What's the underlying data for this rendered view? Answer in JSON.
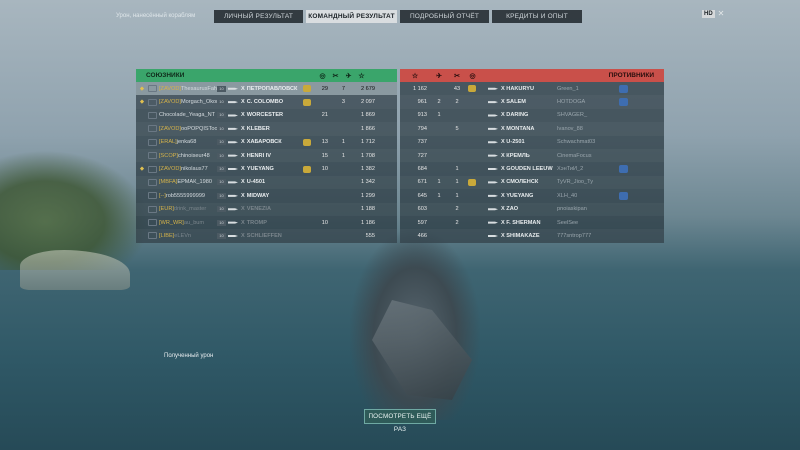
{
  "top_left_label": "Урон, нанесённый кораблям",
  "tabs": [
    {
      "label": "ЛИЧНЫЙ РЕЗУЛЬТАТ",
      "active": false
    },
    {
      "label": "КОМАНДНЫЙ РЕЗУЛЬТАТ",
      "active": true
    },
    {
      "label": "ПОДРОБНЫЙ ОТЧЁТ",
      "active": false
    },
    {
      "label": "КРЕДИТЫ И ОПЫТ",
      "active": false
    }
  ],
  "top_right": {
    "hd_badge": "HD"
  },
  "allies": {
    "title": "СОЮЗНИКИ",
    "rows": [
      {
        "clan": "[ZAVOD]",
        "name": "ThesaurusFahm",
        "tier": "10",
        "ship": "ПЕТРОПАВЛОВСК",
        "kills": "29",
        "planes": "7",
        "xp": "2 679",
        "me": true
      },
      {
        "clan": "[ZAVOD]",
        "name": "Morgach_Okor",
        "tier": "10",
        "ship": "C. COLOMBO",
        "kills": "",
        "planes": "3",
        "xp": "2 097",
        "me": false
      },
      {
        "clan": "",
        "name": "Chocolade_Yeaga_NT",
        "tier": "10",
        "ship": "WORCESTER",
        "kills": "21",
        "planes": "",
        "xp": "1 869",
        "me": false
      },
      {
        "clan": "[ZAVOD]",
        "name": "ooPOPQISToo",
        "tier": "10",
        "ship": "KLÉBER",
        "kills": "",
        "planes": "",
        "xp": "1 866",
        "me": false
      },
      {
        "clan": "[ERAL]",
        "name": "jenka68",
        "tier": "10",
        "ship": "ХАБАРОВСК",
        "kills": "13",
        "planes": "1",
        "xp": "1 712",
        "me": false
      },
      {
        "clan": "[SCOP]",
        "name": "chinoiseur48",
        "tier": "10",
        "ship": "HENRI IV",
        "kills": "15",
        "planes": "1",
        "xp": "1 708",
        "me": false
      },
      {
        "clan": "[ZAVOD]",
        "name": "nikolaus77",
        "tier": "10",
        "ship": "YUEYANG",
        "kills": "10",
        "planes": "",
        "xp": "1 382",
        "me": false
      },
      {
        "clan": "[MBFA]",
        "name": "ЕРМАК_1980",
        "tier": "10",
        "ship": "U-4501",
        "kills": "",
        "planes": "",
        "xp": "1 342",
        "me": false
      },
      {
        "clan": "[--]",
        "name": "rob5555999999",
        "tier": "10",
        "ship": "MIDWAY",
        "kills": "",
        "planes": "",
        "xp": "1 299",
        "me": false
      },
      {
        "clan": "[EUR]",
        "name": "drink_master",
        "tier": "10",
        "ship": "VENEZIA",
        "kills": "",
        "planes": "",
        "xp": "1 188",
        "me": false
      },
      {
        "clan": "[WR_WR]",
        "name": "au_bum",
        "tier": "10",
        "ship": "TROMP",
        "kills": "10",
        "planes": "",
        "xp": "1 186",
        "me": false
      },
      {
        "clan": "[LIBE]",
        "name": "eLEVn",
        "tier": "10",
        "ship": "SCHLIEFFEN",
        "kills": "",
        "planes": "",
        "xp": "555",
        "me": false
      }
    ]
  },
  "enemies": {
    "title": "ПРОТИВНИКИ",
    "rows": [
      {
        "dmg": "1 162",
        "a": "",
        "b": "43",
        "ship": "HAKURYŪ",
        "name": "Green_1"
      },
      {
        "dmg": "961",
        "a": "2",
        "b": "2",
        "ship": "SALEM",
        "name": "HOTDOGA"
      },
      {
        "dmg": "913",
        "a": "1",
        "b": "",
        "ship": "DARING",
        "name": "SHVAGER_"
      },
      {
        "dmg": "794",
        "a": "",
        "b": "5",
        "ship": "MONTANA",
        "name": "Ivanov_88"
      },
      {
        "dmg": "737",
        "a": "",
        "b": "",
        "ship": "U-2501",
        "name": "Schwachmat03"
      },
      {
        "dmg": "727",
        "a": "",
        "b": "",
        "ship": "КРЕМЛЬ",
        "name": "CinemaFocus"
      },
      {
        "dmg": "684",
        "a": "",
        "b": "1",
        "ship": "GOUDEN LEEUW",
        "name": "ХэнТиИ_2"
      },
      {
        "dmg": "671",
        "a": "1",
        "b": "1",
        "ship": "СМОЛЕНСК",
        "name": "TyVR_Jioo_Ty"
      },
      {
        "dmg": "645",
        "a": "1",
        "b": "1",
        "ship": "YUEYANG",
        "name": "XLH_40"
      },
      {
        "dmg": "603",
        "a": "",
        "b": "2",
        "ship": "ZAO",
        "name": "pnoiaskipan"
      },
      {
        "dmg": "597",
        "a": "",
        "b": "2",
        "ship": "F. SHERMAN",
        "name": "SeelSee"
      },
      {
        "dmg": "466",
        "a": "",
        "b": "",
        "ship": "SHIMAKAZE",
        "name": "777sntrop777"
      }
    ]
  },
  "received_damage_label": "Полученный урон",
  "replay_button": "ПОСМОТРЕТЬ ЕЩЁ РАЗ"
}
